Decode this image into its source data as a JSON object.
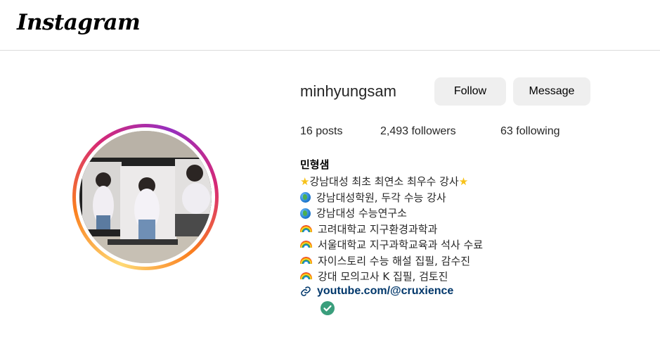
{
  "brand": {
    "logo_text": "Instagram"
  },
  "profile": {
    "username": "minhyungsam",
    "follow_label": "Follow",
    "message_label": "Message",
    "stats": {
      "posts": "16 posts",
      "followers": "2,493 followers",
      "following": "63 following"
    },
    "full_name": "민형샘",
    "bio": [
      {
        "icon": "star-icon",
        "text": "강남대성 최초 최연소 최우수 강사",
        "trail": "star-icon"
      },
      {
        "icon": "globe-icon",
        "text": "강남대성학원, 두각 수능 강사"
      },
      {
        "icon": "globe-icon",
        "text": "강남대성 수능연구소"
      },
      {
        "icon": "rainbow-icon",
        "text": "고려대학교 지구환경과학과"
      },
      {
        "icon": "rainbow-icon",
        "text": "서울대학교 지구과학교육과 석사 수료"
      },
      {
        "icon": "rainbow-icon",
        "text": "자이스토리 수능 해설 집필, 감수진"
      },
      {
        "icon": "rainbow-icon",
        "text": "강대 모의고사 K 집필, 검토진"
      }
    ],
    "link": "youtube.com/@cruxience"
  },
  "colors": {
    "link": "#00376b",
    "button_bg": "#efefef",
    "verified": "#3a9e7c"
  }
}
